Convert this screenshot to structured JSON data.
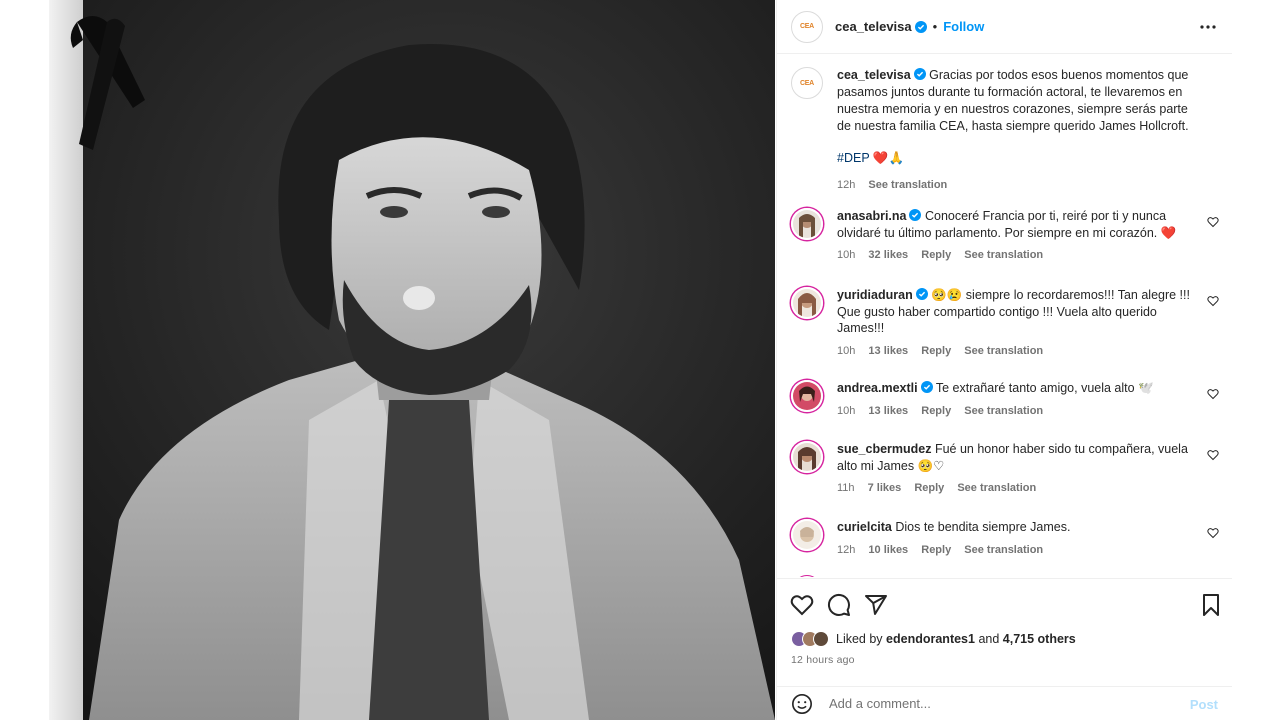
{
  "post": {
    "account": "cea_televisa",
    "avatar_text": "CEA",
    "separator": "•",
    "follow_label": "Follow",
    "caption": {
      "username": "cea_televisa",
      "text": "Gracias por todos esos buenos momentos que pasamos juntos durante tu formación actoral, te llevaremos en nuestra memoria y en nuestros corazones, siempre serás parte de nuestra familia CEA, hasta siempre querido James Hollcroft.",
      "hashtag": "#DEP",
      "emojis": "❤️🙏",
      "time": "12h",
      "see_translation": "See translation"
    },
    "comments": [
      {
        "username": "anasabri.na",
        "verified": true,
        "text": "Conoceré Francia por ti, reiré por ti y nunca olvidaré tu último parlamento. Por siempre en mi corazón. ❤️",
        "time": "10h",
        "likes": "32 likes",
        "reply": "Reply",
        "see_translation": "See translation",
        "avatar_color": "#6b4f3a"
      },
      {
        "username": "yuridiaduran",
        "verified": true,
        "text": "🥺😢 siempre lo recordaremos!!! Tan alegre !!! Que gusto haber compartido contigo !!! Vuela alto querido James!!!",
        "time": "10h",
        "likes": "13 likes",
        "reply": "Reply",
        "see_translation": "See translation",
        "avatar_color": "#8a5a44"
      },
      {
        "username": "andrea.mextli",
        "verified": true,
        "text": "Te extrañaré tanto amigo, vuela alto 🕊️",
        "time": "10h",
        "likes": "13 likes",
        "reply": "Reply",
        "see_translation": "See translation",
        "avatar_color": "#b0384f"
      },
      {
        "username": "sue_cbermudez",
        "verified": false,
        "text": "Fué un honor haber sido tu compañera, vuela alto mi James 🥺♡",
        "time": "11h",
        "likes": "7 likes",
        "reply": "Reply",
        "see_translation": "See translation",
        "avatar_color": "#5a3b2e"
      },
      {
        "username": "curielcita",
        "verified": false,
        "text": "Dios te bendita siempre James.",
        "time": "12h",
        "likes": "10 likes",
        "reply": "Reply",
        "see_translation": "See translation",
        "avatar_color": "#c9b29a"
      }
    ],
    "liked_by_prefix": "Liked by",
    "liked_by_user": "edendorantes1",
    "liked_by_and": "and",
    "liked_by_others": "4,715 others",
    "timestamp": "12 hours ago",
    "comment_placeholder": "Add a comment...",
    "post_label": "Post"
  },
  "icons": [
    "more-icon",
    "verified-icon",
    "heart-icon",
    "comment-icon",
    "share-icon",
    "save-icon",
    "emoji-icon",
    "mourning-ribbon-icon"
  ],
  "colors": {
    "link": "#0095f6",
    "hashtag": "#00376b",
    "muted": "#737373",
    "post_disabled": "#b2dffc",
    "story_ring": "#d6249f"
  }
}
